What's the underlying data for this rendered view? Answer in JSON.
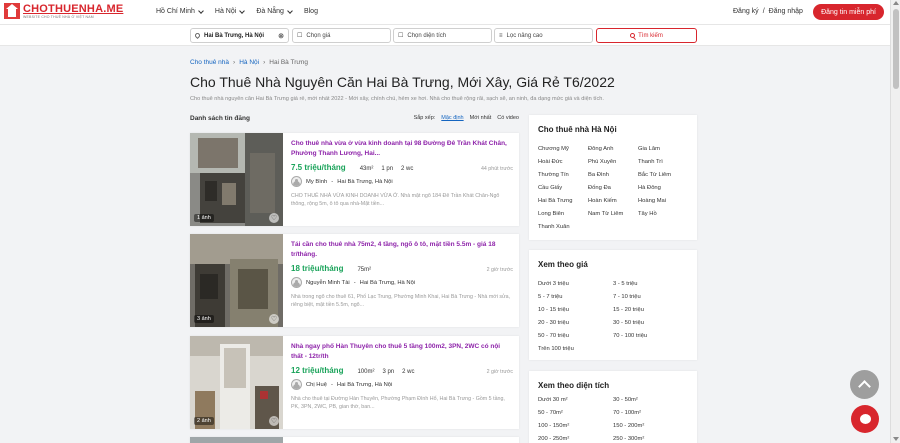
{
  "header": {
    "logo_name": "CHOTHUENHA.ME",
    "logo_tagline": "WEBSITE CHO THUÊ NHÀ Ở VIỆT NAM",
    "nav": [
      {
        "label": "Hồ Chí Minh",
        "dropdown": true
      },
      {
        "label": "Hà Nội",
        "dropdown": true
      },
      {
        "label": "Đà Nẵng",
        "dropdown": true
      },
      {
        "label": "Blog",
        "dropdown": false
      }
    ],
    "register": "Đăng ký",
    "separator": "/",
    "login": "Đăng nhập",
    "post_button": "Đăng tin miễn phí"
  },
  "search": {
    "location": "Hai Bà Trưng, Hà Nội",
    "price_placeholder": "Chọn giá",
    "area_placeholder": "Chọn diện tích",
    "advanced": "Lọc nâng cao",
    "button": "Tìm kiếm"
  },
  "breadcrumb": [
    "Cho thuê nhà",
    "Hà Nội",
    "Hai Bà Trưng"
  ],
  "page": {
    "title": "Cho Thuê Nhà Nguyên Căn Hai Bà Trưng, Mới Xây, Giá Rẻ T6/2022",
    "description": "Cho thuê nhà nguyên căn Hai Bà Trưng giá rẻ, mới nhất 2022 - Mới xây, chính chủ, hẻm xe hơi. Nhà cho thuê rộng rãi, sạch sẽ, an ninh, đa dạng mức giá và diện tích."
  },
  "list": {
    "label": "Danh sách tin đăng",
    "sort_label": "Sắp xếp:",
    "sort_options": [
      "Mặc định",
      "Mới nhất",
      "Có video"
    ],
    "sort_active": "Mặc định"
  },
  "listings": [
    {
      "title": "Cho thuê nhà vừa ở vừa kinh doanh tại 98 Đường Đê Trần Khát Chân, Phường Thanh Lương, Hai...",
      "price": "7.5 triệu/tháng",
      "area": "43m²",
      "bedrooms": "1 pn",
      "wc": "2 wc",
      "ago": "44 phút trước",
      "owner": "My Bình",
      "location": "Hai Bà Trưng, Hà Nội",
      "excerpt": "CHO THUÊ NHÀ VỪA KINH DOANH VỪA Ở. Nhà mặt ngõ 184 Đê Trần Khát Chân-Ngõ thông, rộng 5m, ô tô qua nhà-Mặt tiền...",
      "photos": "1 ảnh"
    },
    {
      "title": "Tái cần cho thuê nhà 75m2, 4 tầng, ngõ ô tô, mặt tiền 5.5m - giá 18 tr/tháng.",
      "price": "18 triệu/tháng",
      "area": "75m²",
      "bedrooms": "",
      "wc": "",
      "ago": "2 giờ trước",
      "owner": "Nguyễn Minh Tài",
      "location": "Hai Bà Trưng, Hà Nội",
      "excerpt": "Nhà trong ngõ cho thuê 61, Phố Lạc Trung, Phường Minh Khai, Hai Bà Trưng - Nhà mới sửa, riêng biệt, mặt tiền 5.5m, ngõ...",
      "photos": "3 ảnh"
    },
    {
      "title": "Nhà ngay phố Hàn Thuyên cho thuê 5 tầng 100m2, 3PN, 2WC có nội thất - 12tr/th",
      "price": "12 triệu/tháng",
      "area": "100m²",
      "bedrooms": "3 pn",
      "wc": "2 wc",
      "ago": "2 giờ trước",
      "owner": "Chị Huệ",
      "location": "Hai Bà Trưng, Hà Nội",
      "excerpt": "Nhà cho thuê tại Đường Hàn Thuyên, Phường Phạm Đình Hổ, Hai Bà Trưng - Gồm 5 tầng, PK, 3PN, 2WC, PB, gian thờ, ban...",
      "photos": "2 ảnh"
    }
  ],
  "sidebar": {
    "districts_title": "Cho thuê nhà Hà Nội",
    "districts": [
      "Chương Mỹ",
      "Đông Anh",
      "Gia Lâm",
      "Hoài Đức",
      "Phú Xuyên",
      "Thanh Trì",
      "Thường Tín",
      "Ba Đình",
      "Bắc Từ Liêm",
      "Cầu Giấy",
      "Đống Đa",
      "Hà Đông",
      "Hai Bà Trưng",
      "Hoàn Kiếm",
      "Hoàng Mai",
      "Long Biên",
      "Nam Từ Liêm",
      "Tây Hồ",
      "Thanh Xuân"
    ],
    "price_title": "Xem theo giá",
    "prices": [
      "Dưới 3 triệu",
      "3 - 5 triệu",
      "5 - 7 triệu",
      "7 - 10 triệu",
      "10 - 15 triệu",
      "15 - 20 triệu",
      "20 - 30 triệu",
      "30 - 50 triệu",
      "50 - 70 triệu",
      "70 - 100 triệu",
      "Trên 100 triệu"
    ],
    "area_title": "Xem theo diện tích",
    "areas": [
      "Dưới 30 m²",
      "30 - 50m²",
      "50 - 70m²",
      "70 - 100m²",
      "100 - 150m²",
      "150 - 200m²",
      "200 - 250m²",
      "250 - 300m²"
    ]
  },
  "colors": {
    "brand": "#d8262d",
    "title_purple": "#8e24aa",
    "price_green": "#1aa35a",
    "link_blue": "#1565c0"
  }
}
